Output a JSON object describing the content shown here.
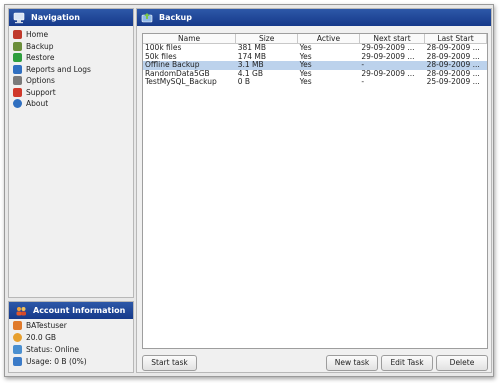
{
  "nav": {
    "title": "Navigation",
    "items": [
      {
        "label": "Home",
        "icon": "home-icon",
        "color": "#c0392b"
      },
      {
        "label": "Backup",
        "icon": "backup-icon",
        "color": "#6b8e3a"
      },
      {
        "label": "Restore",
        "icon": "restore-icon",
        "color": "#2e9e3e"
      },
      {
        "label": "Reports and Logs",
        "icon": "reports-icon",
        "color": "#2f6fc0"
      },
      {
        "label": "Options",
        "icon": "options-icon",
        "color": "#7a7a7a"
      },
      {
        "label": "Support",
        "icon": "support-icon",
        "color": "#d0392b"
      },
      {
        "label": "About",
        "icon": "about-icon",
        "color": "#2f6fc0"
      }
    ]
  },
  "account": {
    "title": "Account Information",
    "user": "BATestuser",
    "quota": "20.0 GB",
    "status": "Status: Online",
    "usage": "Usage: 0 B (0%)"
  },
  "main": {
    "title": "Backup",
    "columns": [
      "Name",
      "Size",
      "Active",
      "Next start",
      "Last Start"
    ],
    "rows": [
      {
        "name": "100k files",
        "size": "381 MB",
        "active": "Yes",
        "next": "29-09-2009 ...",
        "last": "28-09-2009 ...",
        "selected": false
      },
      {
        "name": "50k files",
        "size": "174 MB",
        "active": "Yes",
        "next": "29-09-2009 ...",
        "last": "28-09-2009 ...",
        "selected": false
      },
      {
        "name": "Offline Backup",
        "size": "3.1 MB",
        "active": "Yes",
        "next": "-",
        "last": "28-09-2009 ...",
        "selected": true
      },
      {
        "name": "RandomData5GB",
        "size": "4.1 GB",
        "active": "Yes",
        "next": "29-09-2009 ...",
        "last": "28-09-2009 ...",
        "selected": false
      },
      {
        "name": "TestMySQL_Backup",
        "size": "0 B",
        "active": "Yes",
        "next": "-",
        "last": "25-09-2009 ...",
        "selected": false
      }
    ],
    "buttons": {
      "start": "Start task",
      "new": "New task",
      "edit": "Edit Task",
      "delete": "Delete"
    }
  },
  "colors": {
    "header_blue": "#1f4799",
    "selection": "#bcd2ec"
  }
}
